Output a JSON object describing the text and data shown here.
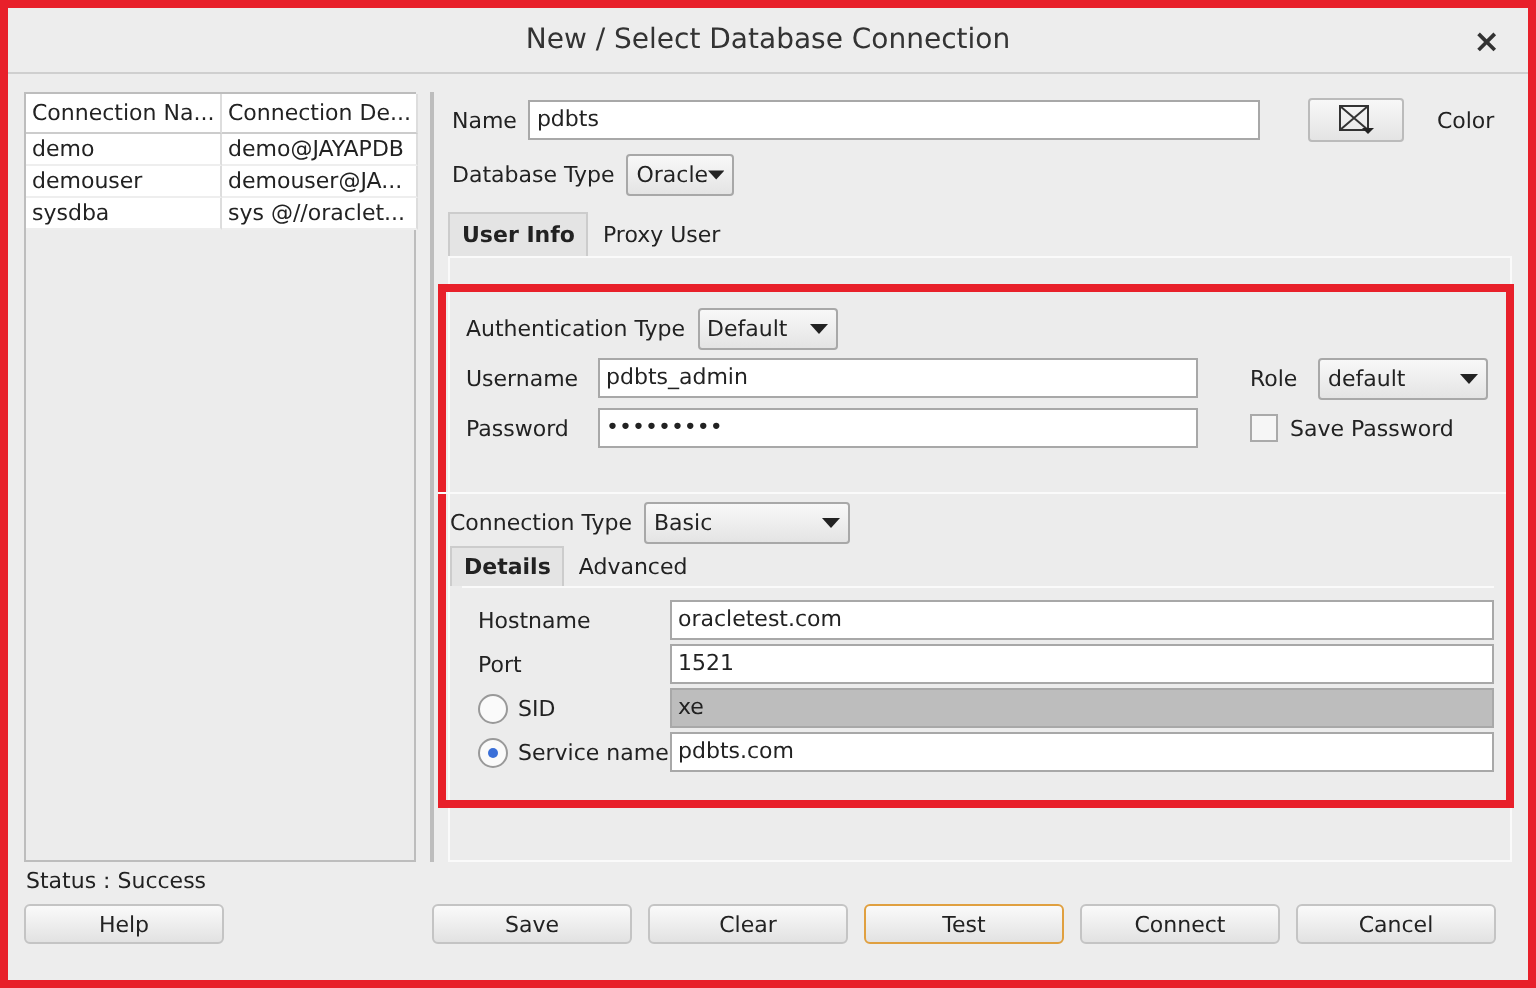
{
  "window": {
    "title": "New / Select Database Connection",
    "close": "×"
  },
  "connections": {
    "columns": [
      "Connection Na...",
      "Connection De..."
    ],
    "rows": [
      {
        "cells": [
          "demo",
          "demo@JAYAPDB"
        ]
      },
      {
        "cells": [
          "demouser",
          "demouser@JA..."
        ]
      },
      {
        "cells": [
          "sysdba",
          "sys @//oraclet..."
        ]
      }
    ]
  },
  "status": "Status : Success",
  "name": {
    "label": "Name",
    "value": "pdbts"
  },
  "color": {
    "label": "Color"
  },
  "database_type": {
    "label": "Database Type",
    "value": "Oracle"
  },
  "tabs": [
    {
      "label": "User Info",
      "selected": true
    },
    {
      "label": "Proxy User",
      "selected": false
    }
  ],
  "authentication_type": {
    "label": "Authentication Type",
    "value": "Default"
  },
  "username": {
    "label": "Username",
    "value": "pdbts_admin"
  },
  "role": {
    "label": "Role",
    "value": "default"
  },
  "password": {
    "label": "Password",
    "value": "•••••••••"
  },
  "save_password": {
    "label": "Save Password",
    "checked": false
  },
  "connection_type": {
    "label": "Connection Type",
    "value": "Basic"
  },
  "detail_tabs": [
    {
      "label": "Details",
      "selected": true
    },
    {
      "label": "Advanced",
      "selected": false
    }
  ],
  "fields": [
    {
      "kind": "text",
      "label": "Hostname",
      "value": "oracletest.com"
    },
    {
      "kind": "text",
      "label": "Port",
      "value": "1521"
    },
    {
      "kind": "radio",
      "label": "SID",
      "value": "xe",
      "selected": false
    },
    {
      "kind": "radio",
      "label": "Service name",
      "value": "pdbts.com",
      "selected": true
    }
  ],
  "buttons": [
    {
      "label": "Help",
      "default": false
    },
    {
      "label": "Save",
      "default": false
    },
    {
      "label": "Clear",
      "default": false
    },
    {
      "label": "Test",
      "default": true
    },
    {
      "label": "Connect",
      "default": false
    },
    {
      "label": "Cancel",
      "default": false
    }
  ]
}
